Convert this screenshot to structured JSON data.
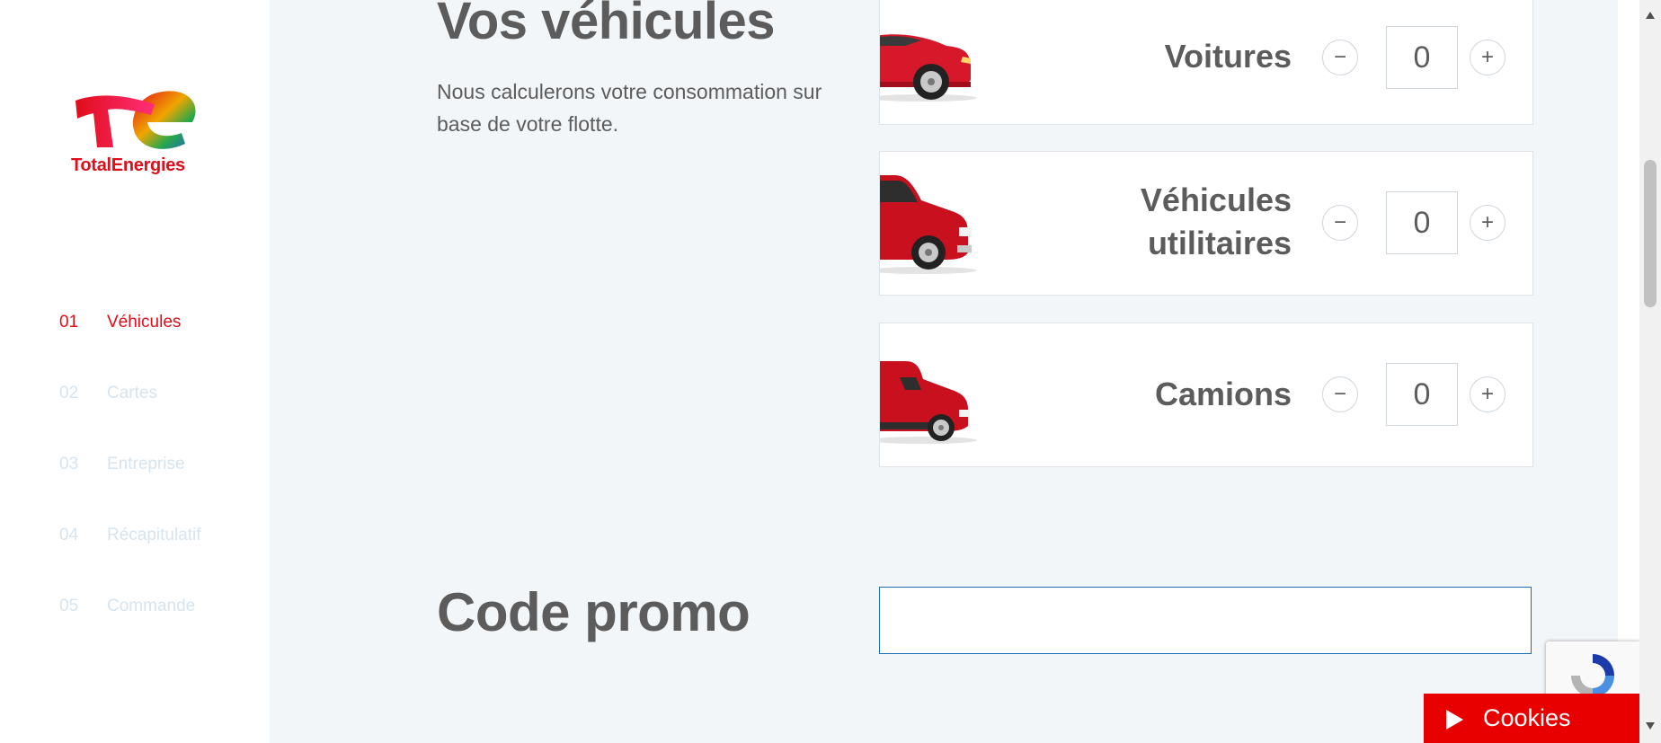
{
  "brand": {
    "name": "TotalEnergies",
    "color": "#e10d1a"
  },
  "steps": [
    {
      "num": "01",
      "label": "Véhicules",
      "state": "active"
    },
    {
      "num": "02",
      "label": "Cartes",
      "state": "inactive"
    },
    {
      "num": "03",
      "label": "Entreprise",
      "state": "inactive"
    },
    {
      "num": "04",
      "label": "Récapitulatif",
      "state": "inactive"
    },
    {
      "num": "05",
      "label": "Commande",
      "state": "inactive"
    }
  ],
  "vehicles": {
    "title": "Vos véhicules",
    "description": "Nous calculerons votre consommation sur base de votre flotte.",
    "items": [
      {
        "label": "Voitures",
        "quantity": "0",
        "icon": "car-icon"
      },
      {
        "label_line1": "Véhicules",
        "label_line2": "utilitaires",
        "quantity": "0",
        "icon": "van-icon"
      },
      {
        "label": "Camions",
        "quantity": "0",
        "icon": "truck-icon"
      }
    ],
    "minus_symbol": "−",
    "plus_symbol": "+"
  },
  "promo": {
    "title": "Code promo",
    "value": ""
  },
  "cookies": {
    "label": "Cookies"
  },
  "colors": {
    "accent": "#e10d1a",
    "cookies_bg": "#e80000",
    "input_border": "#1a6fb5",
    "main_bg": "#f3f6f9"
  }
}
